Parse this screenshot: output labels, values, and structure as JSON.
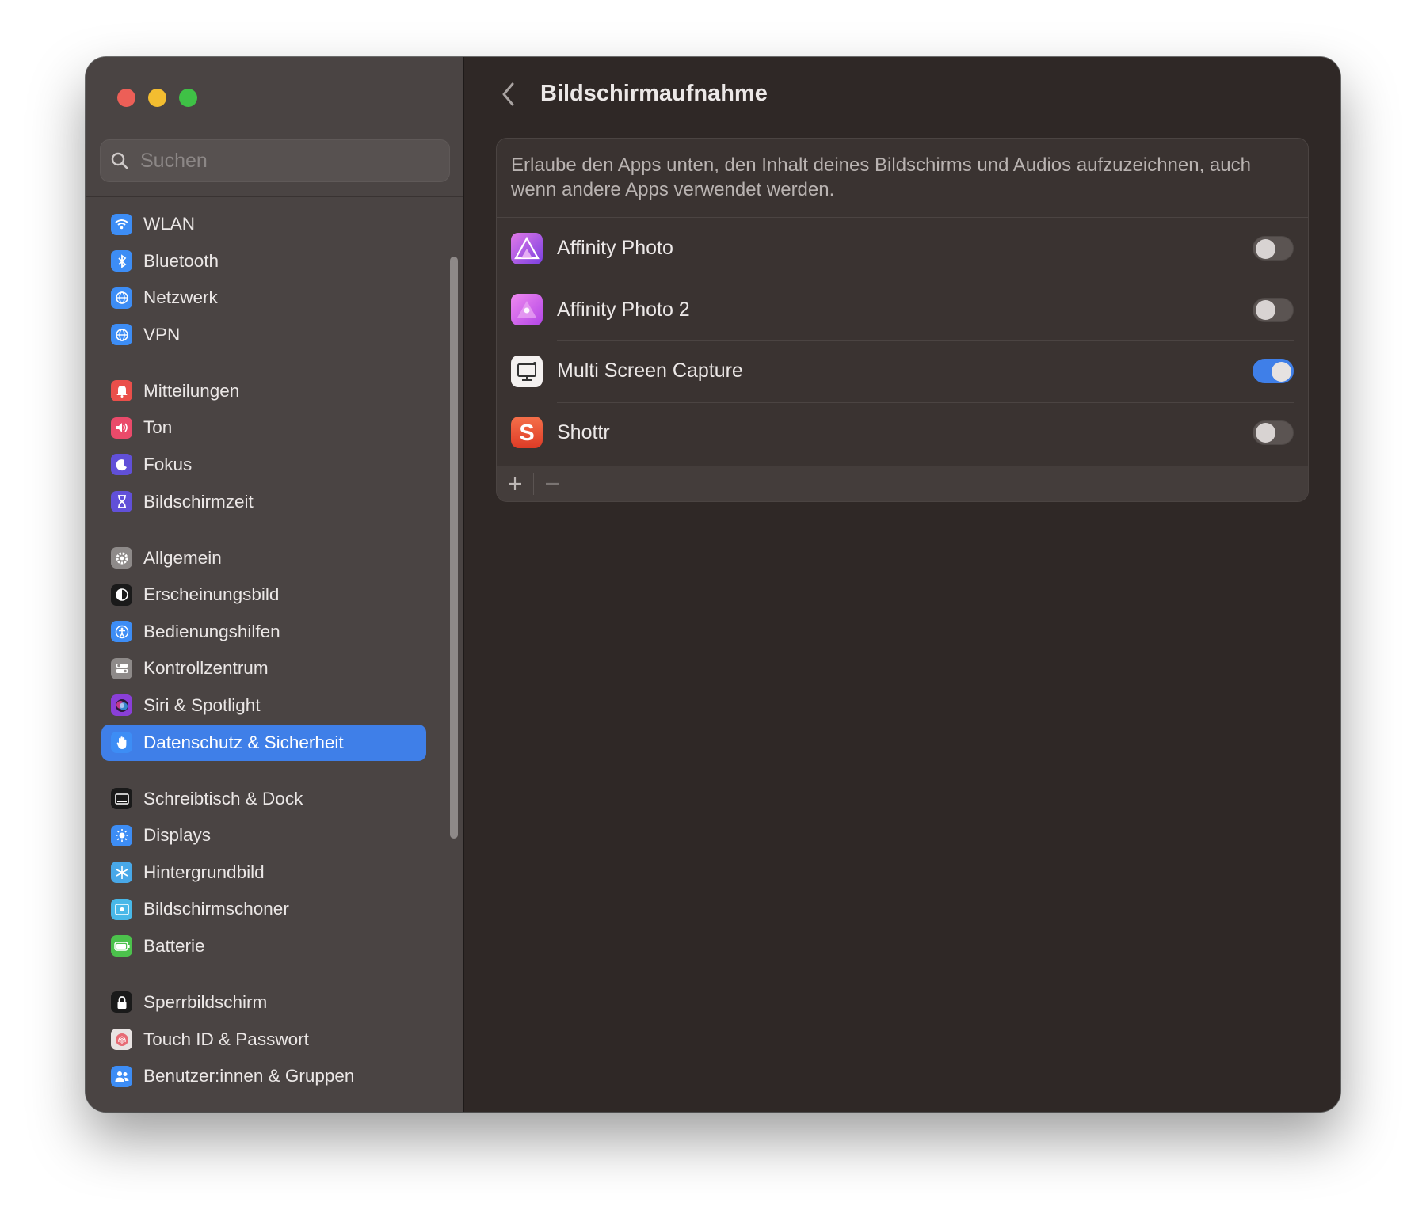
{
  "window": {
    "traffic_lights": [
      "close",
      "minimize",
      "zoom"
    ]
  },
  "sidebar": {
    "search": {
      "placeholder": "Suchen",
      "value": ""
    },
    "groups": [
      [
        {
          "label": "WLAN",
          "icon": "wifi-icon",
          "color": "#3d8df5"
        },
        {
          "label": "Bluetooth",
          "icon": "bluetooth-icon",
          "color": "#3d8df5"
        },
        {
          "label": "Netzwerk",
          "icon": "globe-icon",
          "color": "#3d8df5"
        },
        {
          "label": "VPN",
          "icon": "vpn-globe-icon",
          "color": "#3d8df5"
        }
      ],
      [
        {
          "label": "Mitteilungen",
          "icon": "bell-icon",
          "color": "#ea4f4a"
        },
        {
          "label": "Ton",
          "icon": "speaker-icon",
          "color": "#ea4a6a"
        },
        {
          "label": "Fokus",
          "icon": "moon-icon",
          "color": "#6150d8"
        },
        {
          "label": "Bildschirmzeit",
          "icon": "hourglass-icon",
          "color": "#6150d8"
        }
      ],
      [
        {
          "label": "Allgemein",
          "icon": "gear-icon",
          "color": "#8e8a89"
        },
        {
          "label": "Erscheinungsbild",
          "icon": "appearance-icon",
          "color": "#1a1a1a"
        },
        {
          "label": "Bedienungshilfen",
          "icon": "accessibility-icon",
          "color": "#3d8df5"
        },
        {
          "label": "Kontrollzentrum",
          "icon": "control-center-icon",
          "color": "#8e8a89"
        },
        {
          "label": "Siri & Spotlight",
          "icon": "siri-icon",
          "color": "#8a3fd8"
        },
        {
          "label": "Datenschutz & Sicherheit",
          "icon": "hand-icon",
          "color": "#3d8df5",
          "active": true
        }
      ],
      [
        {
          "label": "Schreibtisch & Dock",
          "icon": "dock-icon",
          "color": "#1a1a1a"
        },
        {
          "label": "Displays",
          "icon": "sun-icon",
          "color": "#3d8df5"
        },
        {
          "label": "Hintergrundbild",
          "icon": "snowflake-icon",
          "color": "#48a8e8"
        },
        {
          "label": "Bildschirmschoner",
          "icon": "screensaver-icon",
          "color": "#48b8e8"
        },
        {
          "label": "Batterie",
          "icon": "battery-icon",
          "color": "#4cc24c"
        }
      ],
      [
        {
          "label": "Sperrbildschirm",
          "icon": "lock-icon",
          "color": "#1a1a1a"
        },
        {
          "label": "Touch ID & Passwort",
          "icon": "fingerprint-icon",
          "color": "#e8e3e2"
        },
        {
          "label": "Benutzer:innen & Gruppen",
          "icon": "users-icon",
          "color": "#3d8df5"
        }
      ]
    ]
  },
  "main": {
    "title": "Bildschirmaufnahme",
    "description": "Erlaube den Apps unten, den Inhalt deines Bildschirms und Audios aufzuzeichnen, auch wenn andere Apps verwendet werden.",
    "apps": [
      {
        "name": "Affinity Photo",
        "icon": "affinity-photo-icon",
        "enabled": false
      },
      {
        "name": "Affinity Photo 2",
        "icon": "affinity-photo-2-icon",
        "enabled": false
      },
      {
        "name": "Multi Screen Capture",
        "icon": "multi-screen-capture-icon",
        "enabled": true
      },
      {
        "name": "Shottr",
        "icon": "shottr-icon",
        "enabled": false
      }
    ],
    "footer": {
      "add": "+",
      "remove": "−"
    }
  }
}
